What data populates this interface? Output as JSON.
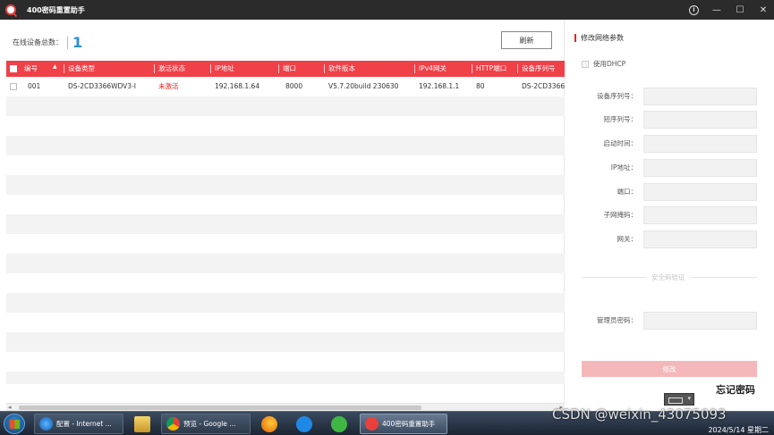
{
  "window": {
    "title": "400密码重置助手"
  },
  "summary": {
    "label": "在线设备总数：",
    "count": "1"
  },
  "toolbar": {
    "refresh_label": "刷新"
  },
  "table": {
    "columns": [
      "编号",
      "设备类型",
      "激活状态",
      "IP地址",
      "端口",
      "软件版本",
      "IPv4网关",
      "HTTP端口",
      "设备序列号"
    ],
    "rows": [
      [
        "001",
        "DS-2CD3366WDV3-I",
        "未激活",
        "192.168.1.64",
        "8000",
        "V5.7.20build 230630",
        "192.168.1.1",
        "80",
        "DS-2CD3366W"
      ]
    ]
  },
  "panel": {
    "title": "修改网络参数",
    "dhcp_label": "使用DHCP",
    "fields": [
      "设备序列号：",
      "短序列号：",
      "启动时间：",
      "IP地址：",
      "端口：",
      "子网掩码：",
      "网关："
    ],
    "security_label": "安全码验证",
    "admin_password_label": "管理员密码：",
    "modify_label": "修改",
    "forgot_label": "忘记密码"
  },
  "taskbar": {
    "tasks": [
      "配置 - Internet ...",
      "预览 - Google ...",
      "400密码重置助手"
    ],
    "date": "2024/5/14 星期二"
  },
  "watermark": "CSDN @weixin_43075093",
  "colors": {
    "accent": "#f04048",
    "count_blue": "#2a8de0",
    "status_red": "#e8231c",
    "modify_disabled": "#f5b8ba"
  }
}
